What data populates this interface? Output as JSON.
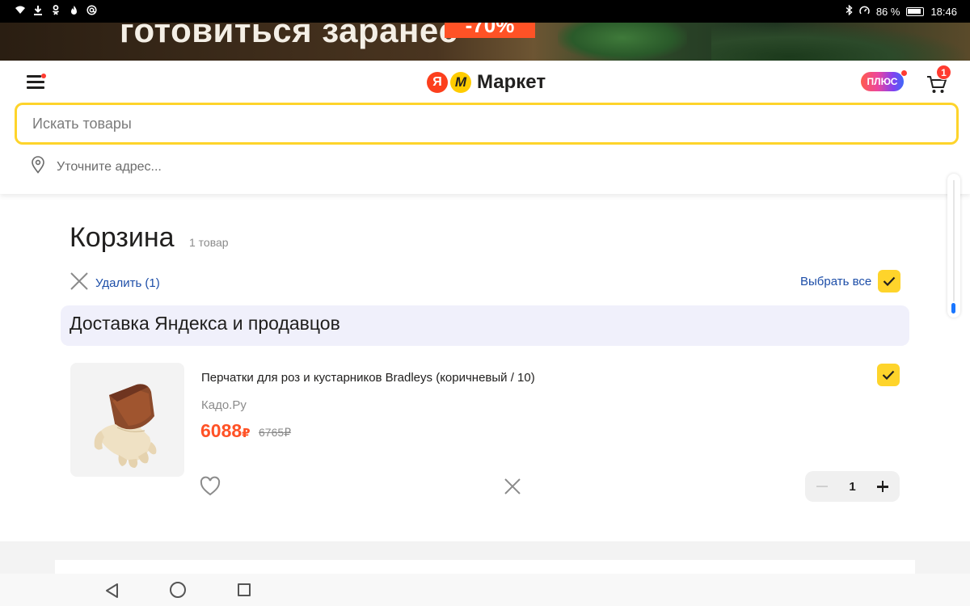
{
  "status_bar": {
    "battery": "86 %",
    "time": "18:46"
  },
  "banner": {
    "text": "готовиться заранее",
    "badge": "-70%"
  },
  "header": {
    "logo_ya": "Я",
    "logo_m": "М",
    "logo_text": "Маркет",
    "plus_label": "ПЛЮС",
    "cart_count": "1",
    "search_placeholder": "Искать товары",
    "address_label": "Уточните адрес..."
  },
  "cart": {
    "title": "Корзина",
    "item_count": "1 товар",
    "delete_label": "Удалить (1)",
    "select_all_label": "Выбрать все",
    "section_title": "Доставка Яндекса и продавцов",
    "items": [
      {
        "name": "Перчатки для роз и кустарников Bradleys (коричневый / 10)",
        "seller": "Кадо.Ру",
        "price": "6088",
        "old_price": "6765",
        "currency": "₽",
        "quantity": "1",
        "checked": true
      }
    ]
  },
  "colors": {
    "accent_yellow": "#fed42b",
    "price_red": "#ff5226",
    "link_blue": "#1d4ea8",
    "section_bg": "#f0f0fb"
  }
}
